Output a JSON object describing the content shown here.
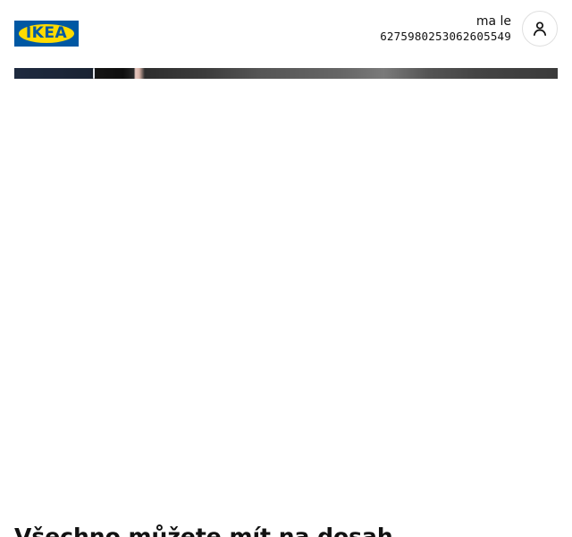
{
  "header": {
    "logo_text": "IKEA",
    "user": {
      "name": "ma le",
      "id": "6275980253062605549"
    },
    "profile_icon": "person-icon"
  },
  "hero": {
    "description": "hero-image-strip"
  },
  "main": {
    "section_heading": "Všechno můžete mít na dosah"
  },
  "colors": {
    "brand_blue": "#0058a3",
    "brand_yellow": "#ffdb00",
    "text": "#111111",
    "border": "#dfdfdf"
  }
}
